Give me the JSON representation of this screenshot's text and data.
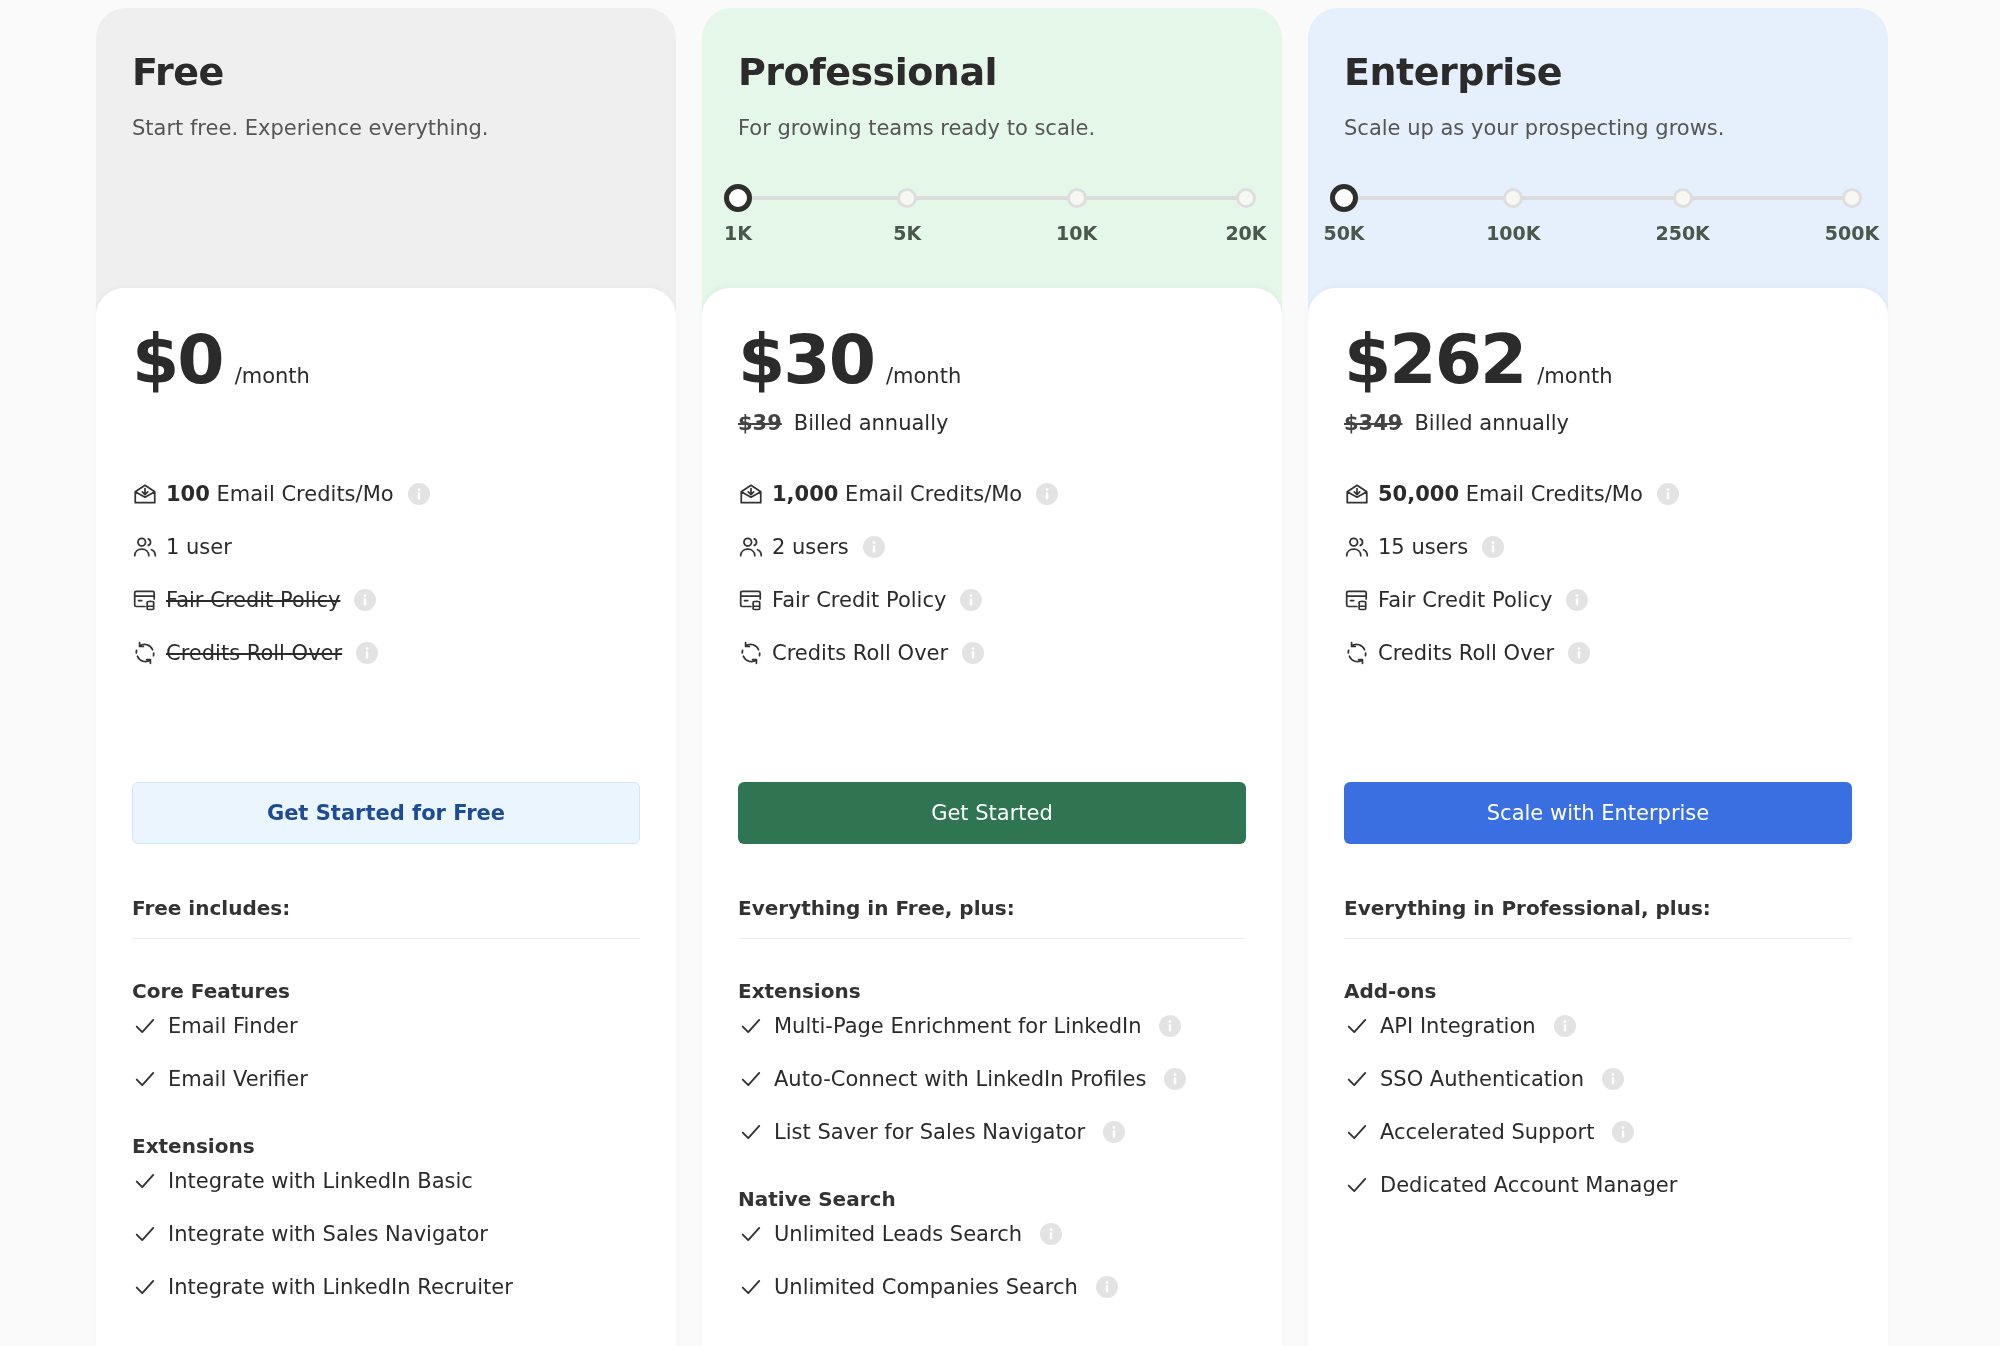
{
  "plans": [
    {
      "kind": "free",
      "name": "Free",
      "tagline": "Start free. Experience everything.",
      "price": "$0",
      "period": "/month",
      "quota": [
        {
          "kind": "credits",
          "text": "**100** Email Credits/Mo",
          "struck": false,
          "info": true
        },
        {
          "kind": "users",
          "text": "1 user",
          "struck": false,
          "info": false
        },
        {
          "kind": "policy",
          "text": "Fair Credit Policy",
          "struck": true,
          "info": true
        },
        {
          "kind": "rollover",
          "text": "Credits Roll Over",
          "struck": true,
          "info": true
        }
      ],
      "button": "Get Started for Free",
      "includes": "Free includes:",
      "groups": [
        {
          "title": "Core Features",
          "items": [
            {
              "text": "Email Finder",
              "info": false
            },
            {
              "text": "Email Verifier",
              "info": false
            }
          ]
        },
        {
          "title": "Extensions",
          "items": [
            {
              "text": "Integrate with LinkedIn Basic",
              "info": false
            },
            {
              "text": "Integrate with Sales Navigator",
              "info": false
            },
            {
              "text": "Integrate with LinkedIn Recruiter",
              "info": false
            }
          ]
        }
      ]
    },
    {
      "kind": "professional",
      "name": "Professional",
      "tagline": "For growing teams ready to scale.",
      "slider": [
        {
          "label": "1K",
          "selected": true
        },
        {
          "label": "5K",
          "selected": false
        },
        {
          "label": "10K",
          "selected": false
        },
        {
          "label": "20K",
          "selected": false
        }
      ],
      "price": "$30",
      "period": "/month",
      "old_price": "$39",
      "billing": "Billed annually",
      "quota": [
        {
          "kind": "credits",
          "text": "**1,000** Email Credits/Mo",
          "struck": false,
          "info": true
        },
        {
          "kind": "users",
          "text": "2 users",
          "struck": false,
          "info": true
        },
        {
          "kind": "policy",
          "text": "Fair Credit Policy",
          "struck": false,
          "info": true
        },
        {
          "kind": "rollover",
          "text": "Credits Roll Over",
          "struck": false,
          "info": true
        }
      ],
      "button": "Get Started",
      "includes": "Everything in Free, plus:",
      "groups": [
        {
          "title": "Extensions",
          "items": [
            {
              "text": "Multi-Page Enrichment for LinkedIn",
              "info": true
            },
            {
              "text": "Auto-Connect with LinkedIn Profiles",
              "info": true
            },
            {
              "text": "List Saver for Sales Navigator",
              "info": true
            }
          ]
        },
        {
          "title": "Native Search",
          "items": [
            {
              "text": "Unlimited Leads Search",
              "info": true
            },
            {
              "text": "Unlimited Companies Search",
              "info": true
            }
          ]
        }
      ]
    },
    {
      "kind": "enterprise",
      "name": "Enterprise",
      "tagline": "Scale up as your prospecting grows.",
      "slider": [
        {
          "label": "50K",
          "selected": true
        },
        {
          "label": "100K",
          "selected": false
        },
        {
          "label": "250K",
          "selected": false
        },
        {
          "label": "500K",
          "selected": false
        }
      ],
      "price": "$262",
      "period": "/month",
      "old_price": "$349",
      "billing": "Billed annually",
      "quota": [
        {
          "kind": "credits",
          "text": "**50,000** Email Credits/Mo",
          "struck": false,
          "info": true
        },
        {
          "kind": "users",
          "text": "15 users",
          "struck": false,
          "info": true
        },
        {
          "kind": "policy",
          "text": "Fair Credit Policy",
          "struck": false,
          "info": true
        },
        {
          "kind": "rollover",
          "text": "Credits Roll Over",
          "struck": false,
          "info": true
        }
      ],
      "button": "Scale with Enterprise",
      "includes": "Everything in Professional, plus:",
      "groups": [
        {
          "title": "Add-ons",
          "items": [
            {
              "text": "API Integration",
              "info": true
            },
            {
              "text": "SSO Authentication",
              "info": true
            },
            {
              "text": "Accelerated Support",
              "info": true
            },
            {
              "text": "Dedicated Account Manager",
              "info": false
            }
          ]
        }
      ]
    }
  ]
}
